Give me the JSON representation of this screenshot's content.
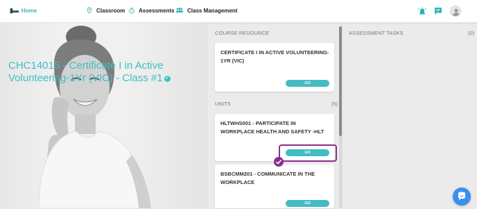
{
  "nav": {
    "home": "Home",
    "classroom": "Classroom",
    "assessments": "Assessments",
    "class_management": "Class Management"
  },
  "hero": {
    "title": "CHC14015 - Certificate I in Active Volunteering-1Yr (VIC) - Class #1"
  },
  "course_resource": {
    "heading": "COURSE RESOURCE",
    "card_title": "CERTIFICATE I IN ACTIVE VOLUNTEERING-1YR (VIC)",
    "go": "GO"
  },
  "units": {
    "heading": "UNITS",
    "count": "(5)",
    "items": [
      {
        "title": "HLTWHS001 - PARTICIPATE IN WORKPLACE HEALTH AND SAFETY -HLT",
        "go": "GO"
      },
      {
        "title": "BSBCMM201 - COMMUNICATE IN THE WORKPLACE",
        "go": "GO"
      }
    ]
  },
  "assessment_tasks": {
    "heading": "ASSESSMENT TASKS",
    "count": "(0)"
  },
  "colors": {
    "accent": "#3dbfc3",
    "highlight": "#8d2d8f",
    "fab": "#3a8ff0"
  },
  "icons": [
    "home-icon",
    "pin-icon",
    "stopwatch-icon",
    "people-icon",
    "alarm-icon",
    "chat-icon",
    "user-avatar-icon",
    "verified-icon",
    "check-icon",
    "chat-bubble-icon"
  ]
}
